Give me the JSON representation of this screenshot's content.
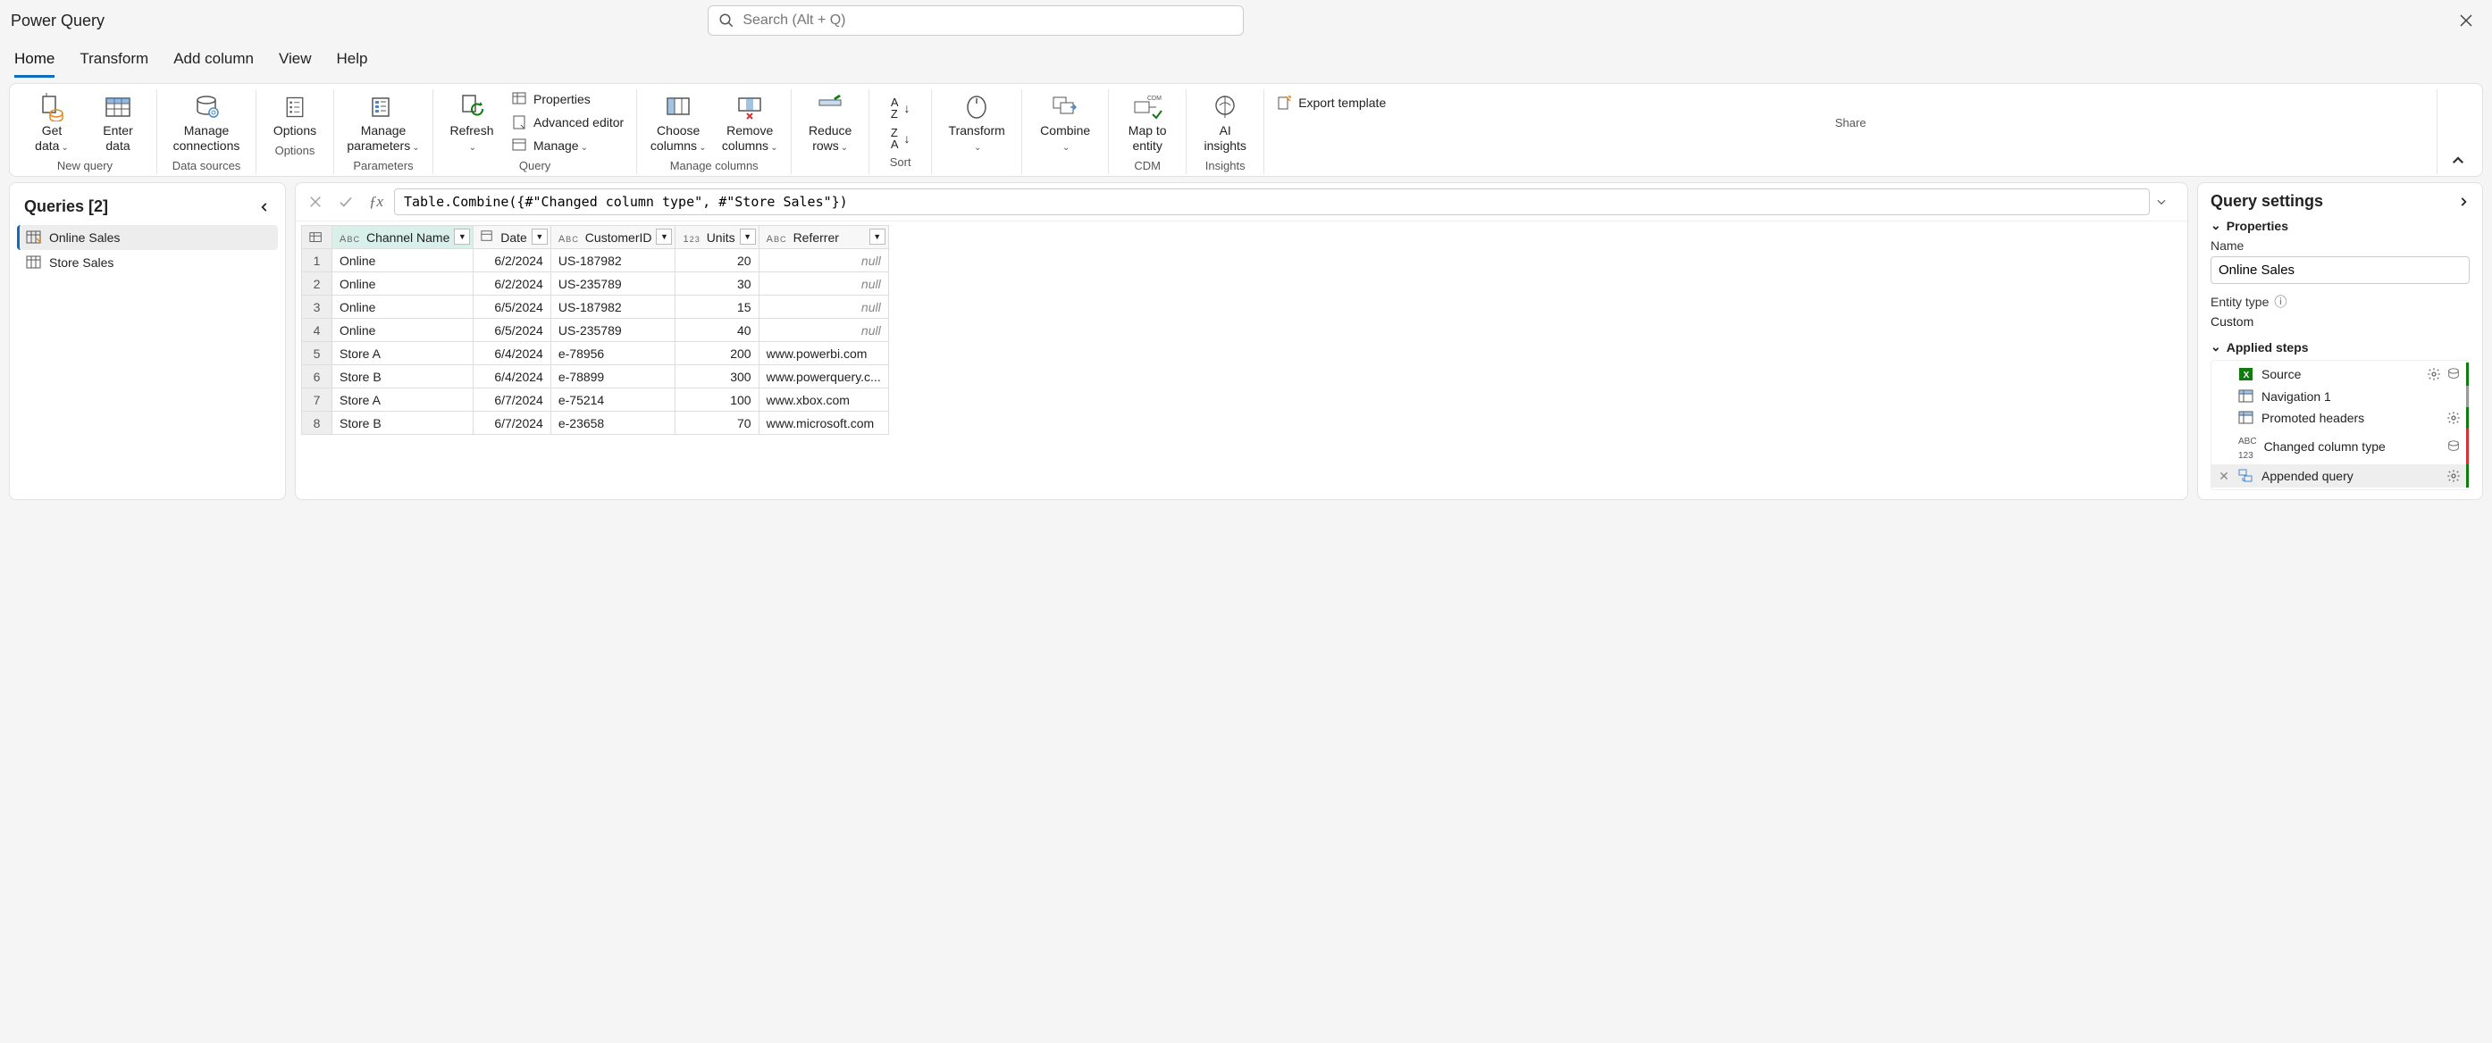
{
  "app_title": "Power Query",
  "search_placeholder": "Search (Alt + Q)",
  "tabs": [
    "Home",
    "Transform",
    "Add column",
    "View",
    "Help"
  ],
  "ribbon": {
    "get_data": "Get data",
    "enter_data": "Enter data",
    "manage_connections": "Manage connections",
    "options": "Options",
    "manage_parameters": "Manage parameters",
    "refresh": "Refresh",
    "properties": "Properties",
    "advanced_editor": "Advanced editor",
    "manage": "Manage",
    "choose_columns": "Choose columns",
    "remove_columns": "Remove columns",
    "reduce_rows": "Reduce rows",
    "transform": "Transform",
    "combine": "Combine",
    "map_to_entity": "Map to entity",
    "ai_insights": "AI insights",
    "export_template": "Export template",
    "groups": {
      "new_query": "New query",
      "data_sources": "Data sources",
      "options": "Options",
      "parameters": "Parameters",
      "query": "Query",
      "manage_columns": "Manage columns",
      "sort": "Sort",
      "cdm": "CDM",
      "insights": "Insights",
      "share": "Share"
    }
  },
  "queries": {
    "title": "Queries [2]",
    "items": [
      {
        "name": "Online Sales",
        "selected": true
      },
      {
        "name": "Store Sales",
        "selected": false
      }
    ]
  },
  "formula": "Table.Combine({#\"Changed column type\", #\"Store Sales\"})",
  "columns": [
    "Channel Name",
    "Date",
    "CustomerID",
    "Units",
    "Referrer"
  ],
  "rows": [
    {
      "n": 1,
      "channel": "Online",
      "date": "6/2/2024",
      "cust": "US-187982",
      "units": 20,
      "ref": null
    },
    {
      "n": 2,
      "channel": "Online",
      "date": "6/2/2024",
      "cust": "US-235789",
      "units": 30,
      "ref": null
    },
    {
      "n": 3,
      "channel": "Online",
      "date": "6/5/2024",
      "cust": "US-187982",
      "units": 15,
      "ref": null
    },
    {
      "n": 4,
      "channel": "Online",
      "date": "6/5/2024",
      "cust": "US-235789",
      "units": 40,
      "ref": null
    },
    {
      "n": 5,
      "channel": "Store A",
      "date": "6/4/2024",
      "cust": "e-78956",
      "units": 200,
      "ref": "www.powerbi.com"
    },
    {
      "n": 6,
      "channel": "Store B",
      "date": "6/4/2024",
      "cust": "e-78899",
      "units": 300,
      "ref": "www.powerquery.c..."
    },
    {
      "n": 7,
      "channel": "Store A",
      "date": "6/7/2024",
      "cust": "e-75214",
      "units": 100,
      "ref": "www.xbox.com"
    },
    {
      "n": 8,
      "channel": "Store B",
      "date": "6/7/2024",
      "cust": "e-23658",
      "units": 70,
      "ref": "www.microsoft.com"
    }
  ],
  "settings": {
    "title": "Query settings",
    "properties_label": "Properties",
    "name_label": "Name",
    "name_value": "Online Sales",
    "entity_type_label": "Entity type",
    "entity_type_value": "Custom",
    "applied_steps_label": "Applied steps",
    "steps": [
      {
        "name": "Source",
        "gear": true,
        "extra": true,
        "marker": "green",
        "icon": "excel"
      },
      {
        "name": "Navigation 1",
        "gear": false,
        "extra": false,
        "marker": "gray",
        "icon": "table"
      },
      {
        "name": "Promoted headers",
        "gear": true,
        "extra": false,
        "marker": "green",
        "icon": "table"
      },
      {
        "name": "Changed column type",
        "gear": false,
        "extra": true,
        "marker": "red",
        "icon": "abc123"
      },
      {
        "name": "Appended query",
        "gear": true,
        "extra": false,
        "marker": "green",
        "icon": "append",
        "selected": true
      }
    ]
  },
  "null_label": "null",
  "info_icon_label": "ⓘ"
}
